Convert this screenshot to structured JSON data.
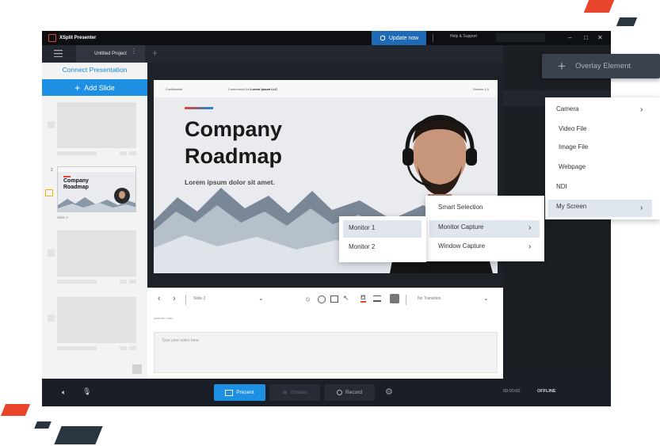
{
  "app": {
    "name": "XSplit Presenter",
    "update_label": "Update now",
    "help_label": "Help & Support",
    "window_controls": [
      "–",
      "□",
      "✕"
    ]
  },
  "left_panel": {
    "project_tab": "Untitled Project",
    "connect_label": "Connect Presentation",
    "add_slide_label": "Add Slide",
    "slide_number": "2",
    "slide_label": "Slide 2",
    "thumb_title_line1": "Company",
    "thumb_title_line2": "Roadmap"
  },
  "slide": {
    "header_left": "Confidential",
    "header_mid_prefix": "Customized for",
    "header_mid_bold": "Lorem Ipsum LLC",
    "header_right": "Version 1.0",
    "title_line1": "Company",
    "title_line2": "Roadmap",
    "subtitle": "Lorem ipsum dolor sit amet."
  },
  "toolbar": {
    "slide_label": "Slide 2",
    "transition": "No Transition"
  },
  "notes": {
    "label": "presenter notes",
    "placeholder": "Type your notes here"
  },
  "overlay": {
    "label": "Overlay Element",
    "menu": [
      "Camera",
      "Video File",
      "Image File",
      "Webpage",
      "NDI",
      "My Screen"
    ]
  },
  "my_screen_menu": [
    "Smart Selection",
    "Monitor Capture",
    "Window Capture"
  ],
  "monitor_menu": [
    "Monitor 1",
    "Monitor 2"
  ],
  "bottom": {
    "present": "Present",
    "stream": "Stream",
    "record": "Record",
    "time": "00:00:00",
    "status": "OFFLINE"
  },
  "colors": {
    "accent": "#1e90e3",
    "brand": "#e8452c",
    "title_accent": "#e8452c"
  }
}
